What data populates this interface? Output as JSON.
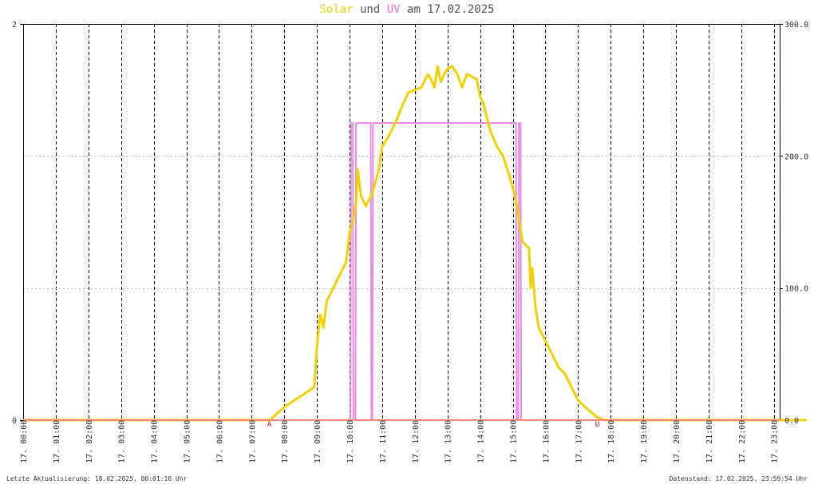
{
  "title": {
    "solar_label": "Solar",
    "und": "und",
    "uv_label": "UV",
    "am_date": "am 17.02.2025"
  },
  "footer": {
    "left": "Letzte Aktualisierung: 18.02.2025, 00:01:16 Uhr",
    "right": "Datenstand: 17.02.2025, 23:59:54 Uhr"
  },
  "markers": {
    "sunrise": "A",
    "sunset": "U"
  },
  "chart_data": {
    "type": "line",
    "title": "Solar und UV am 17.02.2025",
    "x_ticks": [
      "17. 00:00",
      "17. 01:00",
      "17. 02:00",
      "17. 03:00",
      "17. 04:00",
      "17. 05:00",
      "17. 06:00",
      "17. 07:00",
      "17. 08:00",
      "17. 09:00",
      "17. 10:00",
      "17. 11:00",
      "17. 12:00",
      "17. 13:00",
      "17. 14:00",
      "17. 15:00",
      "17. 16:00",
      "17. 17:00",
      "17. 18:00",
      "17. 19:00",
      "17. 20:00",
      "17. 21:00",
      "17. 22:00",
      "17. 23:00"
    ],
    "y_left": {
      "ticks": [
        "0",
        "2"
      ],
      "lim": [
        0,
        2
      ]
    },
    "y_right": {
      "ticks": [
        "0.0",
        "100.0",
        "200.0",
        "300.0"
      ],
      "lim": [
        0,
        300
      ]
    },
    "grid": true,
    "colors": {
      "solar": "#f5d000",
      "uv": "#e88be8",
      "baseline": "#f08a7a",
      "grid": "#000000"
    },
    "series": [
      {
        "name": "Solar",
        "axis": "right",
        "x_hours": [
          0,
          7.55,
          7.7,
          8.0,
          8.5,
          8.92,
          9.0,
          9.1,
          9.2,
          9.3,
          9.5,
          9.7,
          9.9,
          10.0,
          10.1,
          10.2,
          10.25,
          10.35,
          10.5,
          10.7,
          10.9,
          11.0,
          11.2,
          11.4,
          11.6,
          11.8,
          12.0,
          12.2,
          12.4,
          12.5,
          12.6,
          12.7,
          12.8,
          12.9,
          13.0,
          13.15,
          13.3,
          13.45,
          13.6,
          13.75,
          13.9,
          14.0,
          14.1,
          14.3,
          14.5,
          14.7,
          14.9,
          15.0,
          15.1,
          15.3,
          15.5,
          15.55,
          15.6,
          15.7,
          15.8,
          15.9,
          16.0,
          16.2,
          16.4,
          16.6,
          16.8,
          17.0,
          17.3,
          17.6,
          17.8,
          18.0,
          24.0
        ],
        "values": [
          0,
          0,
          3,
          10,
          18,
          25,
          55,
          80,
          70,
          90,
          100,
          110,
          120,
          142,
          150,
          165,
          190,
          170,
          162,
          172,
          190,
          207,
          215,
          225,
          237,
          248,
          250,
          252,
          262,
          258,
          252,
          268,
          256,
          262,
          266,
          268,
          262,
          252,
          262,
          260,
          258,
          245,
          240,
          220,
          208,
          200,
          185,
          176,
          165,
          135,
          130,
          100,
          115,
          85,
          70,
          65,
          60,
          50,
          40,
          35,
          25,
          15,
          8,
          2,
          0,
          0,
          0
        ]
      },
      {
        "name": "UV",
        "axis": "left",
        "x_hours": [
          0,
          10.03,
          10.05,
          10.1,
          10.12,
          10.18,
          10.2,
          10.65,
          10.67,
          10.7,
          10.72,
          15.1,
          15.12,
          15.17,
          15.19,
          15.24,
          15.26,
          15.3,
          15.32,
          24.0
        ],
        "values": [
          0,
          0,
          1.5,
          1.5,
          0,
          0,
          1.5,
          1.5,
          0,
          0,
          1.5,
          1.5,
          0,
          0,
          1.5,
          1.5,
          0,
          0,
          0,
          0
        ]
      }
    ]
  }
}
